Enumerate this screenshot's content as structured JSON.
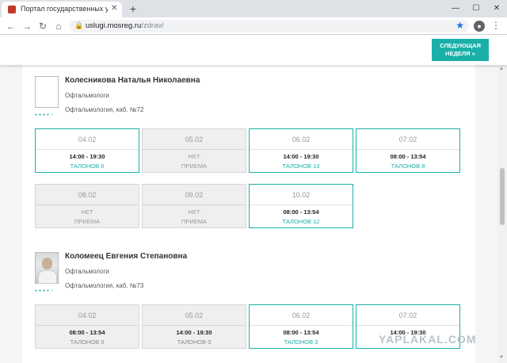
{
  "browser": {
    "tab_title": "Портал государственных услуг",
    "tab_close": "✕",
    "new_tab": "+",
    "url_host": "uslugi.mosreg.ru",
    "url_path": "/zdrav/",
    "win_min": "—",
    "win_max": "☐",
    "win_close": "✕"
  },
  "header": {
    "next_week_line1": "СЛЕДУЮЩАЯ",
    "next_week_line2": "НЕДЕЛЯ »"
  },
  "doctors": [
    {
      "name": "Колесникова Наталья Николаевна",
      "specialty": "Офтальмологи",
      "room": "Офтальмология, каб. №72",
      "slots": [
        {
          "date": "04.02",
          "time": "14:00 - 19:30",
          "tickets": "ТАЛОНОВ 6",
          "active": true
        },
        {
          "date": "05.02",
          "line1": "НЕТ",
          "line2": "ПРИЕМА",
          "active": false
        },
        {
          "date": "06.02",
          "time": "14:00 - 19:30",
          "tickets": "ТАЛОНОВ 13",
          "active": true
        },
        {
          "date": "07.02",
          "time": "08:00 - 13:54",
          "tickets": "ТАЛОНОВ 8",
          "active": true
        },
        {
          "date": "08.02",
          "line1": "НЕТ",
          "line2": "ПРИЕМА",
          "active": false
        },
        {
          "date": "09.02",
          "line1": "НЕТ",
          "line2": "ПРИЕМА",
          "active": false
        },
        {
          "date": "10.02",
          "time": "08:00 - 13:54",
          "tickets": "ТАЛОНОВ 12",
          "active": true
        }
      ]
    },
    {
      "name": "Коломеец Евгения Степановна",
      "specialty": "Офтальмологи",
      "room": "Офтальмология, каб. №73",
      "slots": [
        {
          "date": "04.02",
          "time": "08:00 - 13:54",
          "tickets": "ТАЛОНОВ 0",
          "active": false
        },
        {
          "date": "05.02",
          "time": "14:00 - 19:30",
          "tickets": "ТАЛОНОВ 0",
          "active": false
        },
        {
          "date": "06.02",
          "time": "08:00 - 13:54",
          "tickets": "ТАЛОНОВ 3",
          "active": true
        },
        {
          "date": "07.02",
          "time": "14:00 - 19:30",
          "tickets": "",
          "active": true
        }
      ]
    }
  ],
  "watermark": "YAPLAKAL.COM",
  "colors": {
    "accent": "#1ab0a8",
    "inactive": "#efefef"
  }
}
